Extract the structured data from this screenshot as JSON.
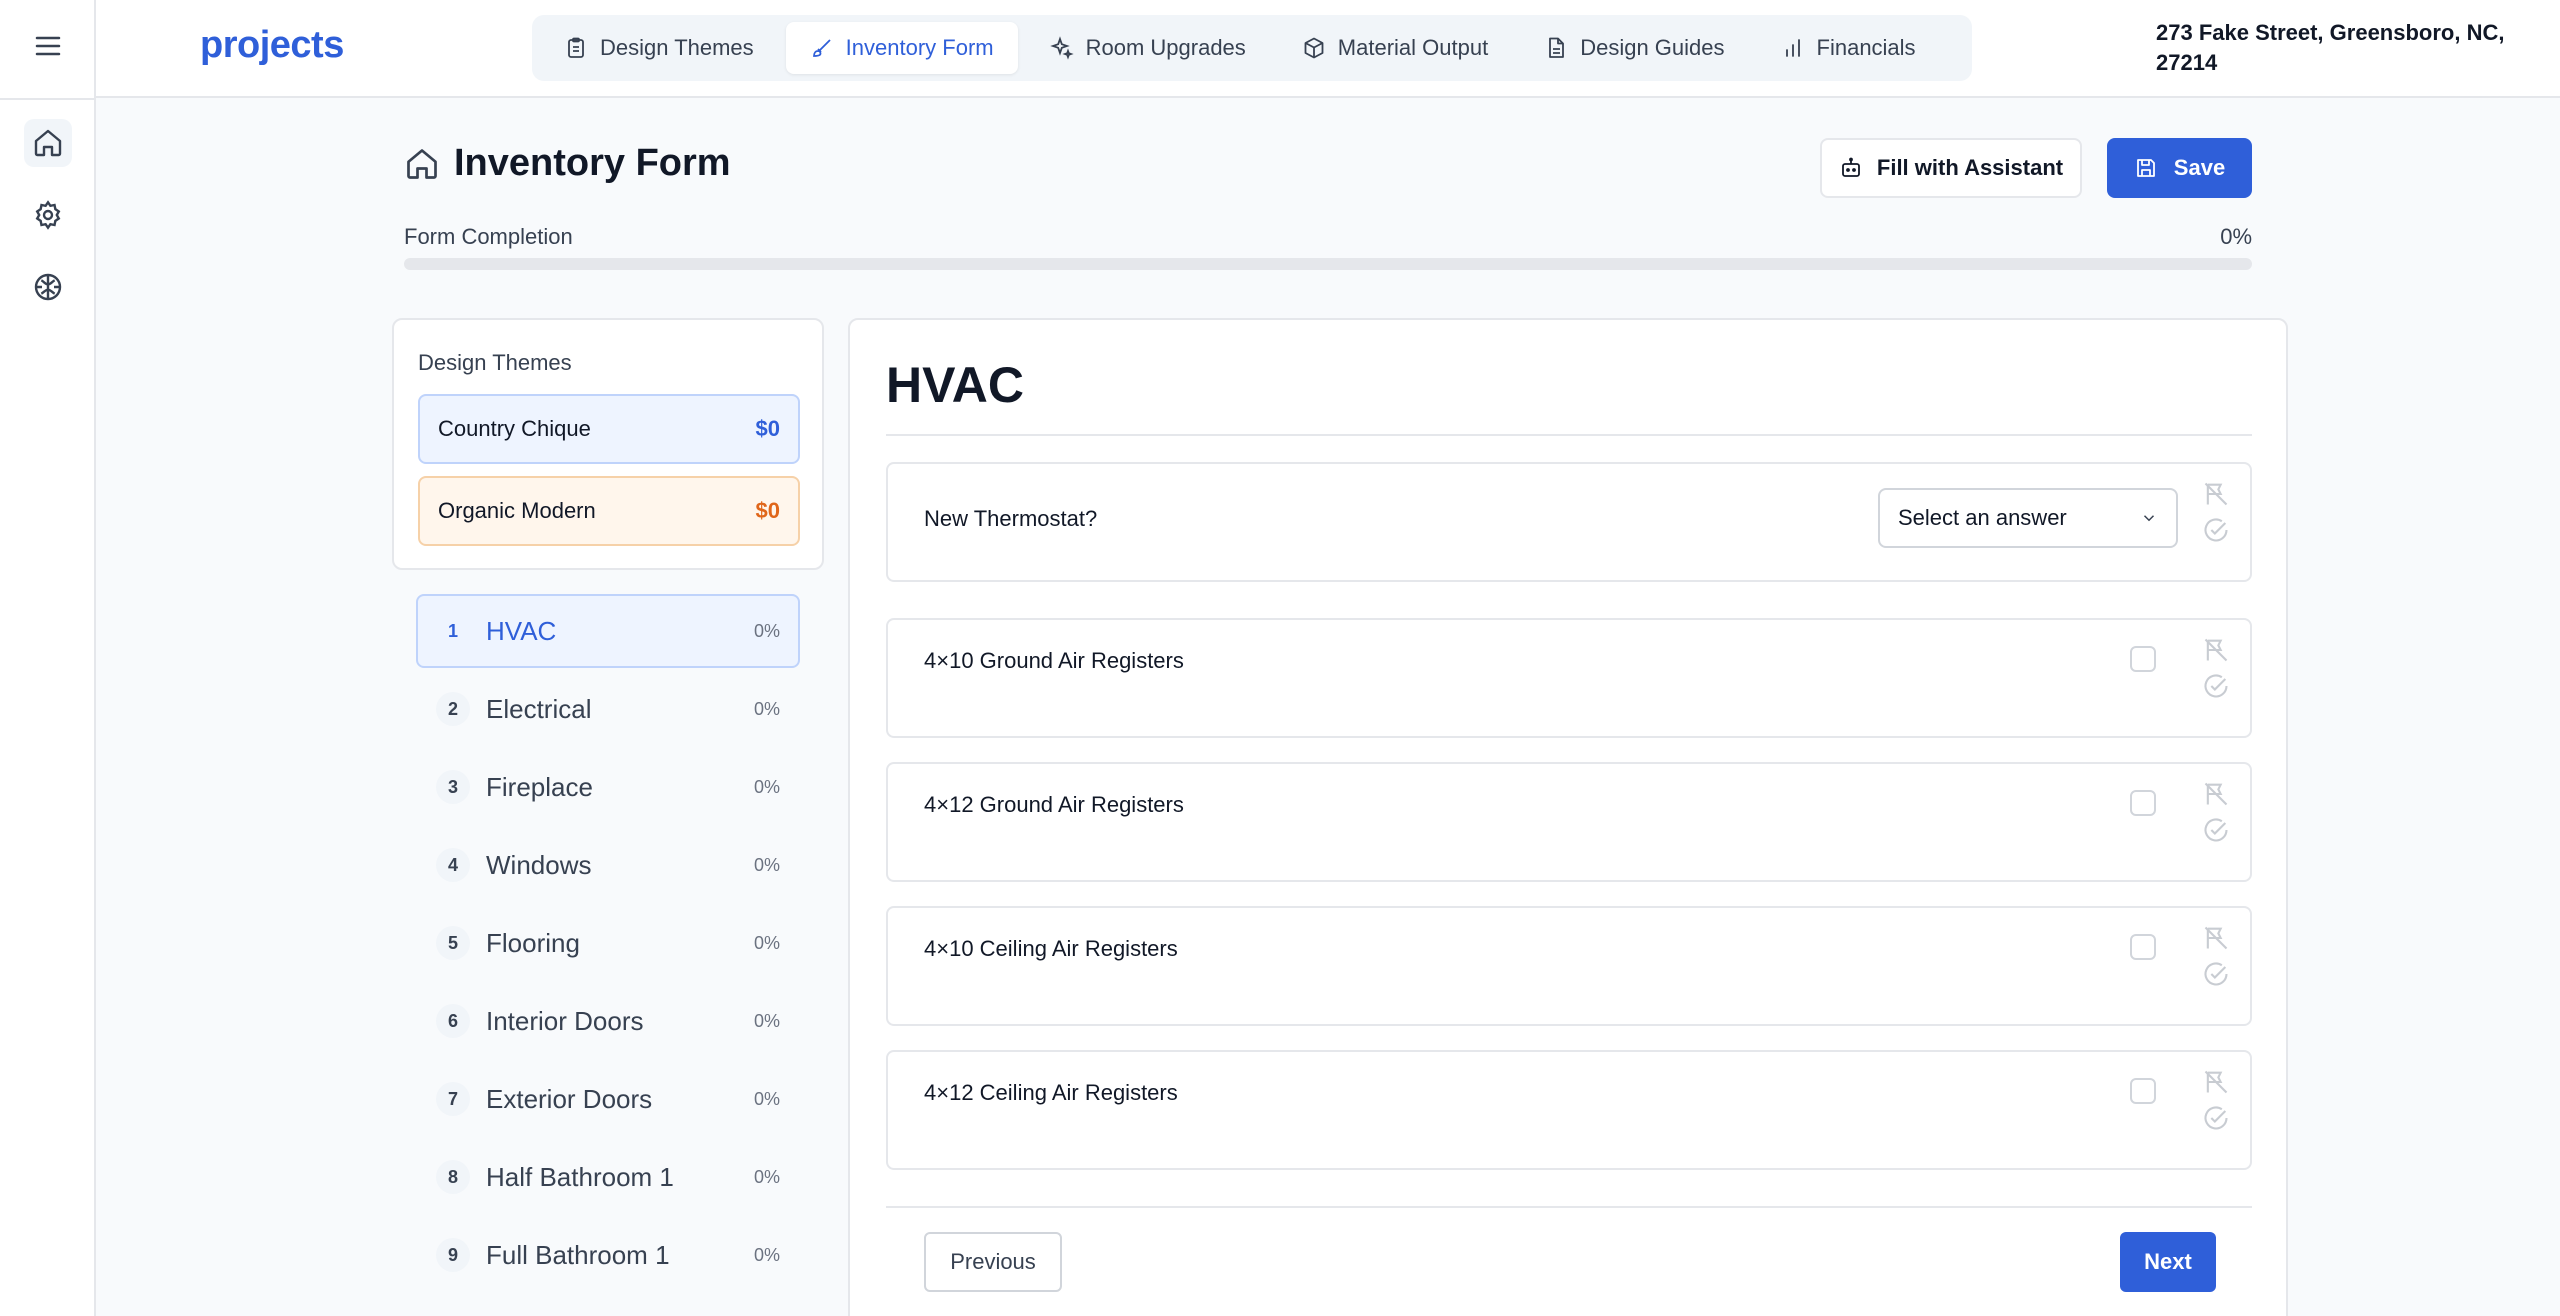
{
  "app": {
    "brand": "projects"
  },
  "rail": {
    "items": [
      {
        "icon": "home-icon"
      },
      {
        "icon": "gear-icon"
      },
      {
        "icon": "brain-icon"
      }
    ]
  },
  "nav": {
    "tabs": [
      {
        "label": "Design Themes",
        "icon": "clipboard-icon"
      },
      {
        "label": "Inventory Form",
        "icon": "brush-icon",
        "active": true
      },
      {
        "label": "Room Upgrades",
        "icon": "sparkles-icon"
      },
      {
        "label": "Material Output",
        "icon": "box-icon"
      },
      {
        "label": "Design Guides",
        "icon": "document-icon"
      },
      {
        "label": "Financials",
        "icon": "bar-chart-icon"
      }
    ],
    "address": "273 Fake Street, Greensboro, NC, 27214"
  },
  "header": {
    "title": "Inventory Form",
    "assistant_label": "Fill with Assistant",
    "save_label": "Save",
    "completion_label": "Form Completion",
    "completion_value": "0%",
    "completion_fraction": 0
  },
  "themes": {
    "title": "Design Themes",
    "items": [
      {
        "name": "Country Chique",
        "price": "$0"
      },
      {
        "name": "Organic Modern",
        "price": "$0"
      }
    ]
  },
  "sections": [
    {
      "num": "1",
      "name": "HVAC",
      "pct": "0%"
    },
    {
      "num": "2",
      "name": "Electrical",
      "pct": "0%"
    },
    {
      "num": "3",
      "name": "Fireplace",
      "pct": "0%"
    },
    {
      "num": "4",
      "name": "Windows",
      "pct": "0%"
    },
    {
      "num": "5",
      "name": "Flooring",
      "pct": "0%"
    },
    {
      "num": "6",
      "name": "Interior Doors",
      "pct": "0%"
    },
    {
      "num": "7",
      "name": "Exterior Doors",
      "pct": "0%"
    },
    {
      "num": "8",
      "name": "Half Bathroom 1",
      "pct": "0%"
    },
    {
      "num": "9",
      "name": "Full Bathroom 1",
      "pct": "0%"
    }
  ],
  "main": {
    "title": "HVAC",
    "questions": [
      {
        "label": "New Thermostat?",
        "type": "select",
        "placeholder": "Select an answer"
      },
      {
        "label": "4×10 Ground Air Registers",
        "type": "checkbox"
      },
      {
        "label": "4×12 Ground Air Registers",
        "type": "checkbox"
      },
      {
        "label": "4×10 Ceiling Air Registers",
        "type": "checkbox"
      },
      {
        "label": "4×12 Ceiling Air Registers",
        "type": "checkbox"
      }
    ],
    "prev_label": "Previous",
    "next_label": "Next"
  },
  "colors": {
    "accent": "#2f5fd9",
    "orange": "#e0661a"
  }
}
